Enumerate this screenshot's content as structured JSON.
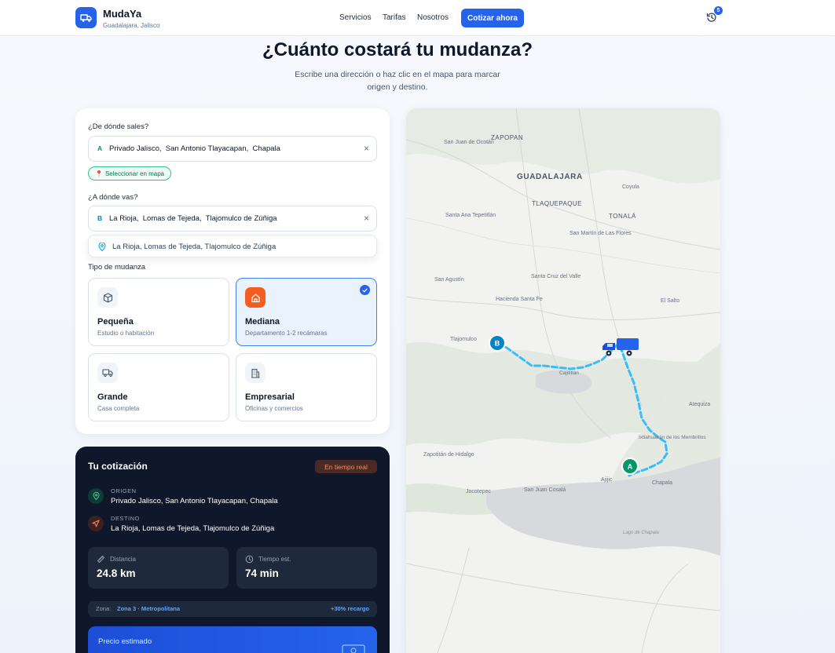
{
  "header": {
    "brand_name": "MudaYa",
    "brand_city": "Guadalajara, Jalisco",
    "nav": [
      "Servicios",
      "Tarifas",
      "Nosotros"
    ],
    "cta_label": "Cotizar ahora",
    "history_count": "5"
  },
  "hero": {
    "title": "¿Cuánto costará tu mudanza?",
    "subtitle": "Escribe una dirección o haz clic en el mapa para marcar origen y destino."
  },
  "form": {
    "origin_label": "¿De dónde sales?",
    "origin_pin": "A",
    "origin_value": "Privado Jalisco,  San Antonio Tlayacapan,  Chapala",
    "select_on_map": "Seleccionar en mapa",
    "dest_label": "¿A dónde vas?",
    "dest_pin": "B",
    "dest_value": "La Rioja,  Lomas de Tejeda,  Tlajomulco de Zúñiga",
    "suggestion": "La Rioja, Lomas de Tejeda, Tlajomulco de Zúñiga",
    "type_label": "Tipo de mudanza",
    "types": [
      {
        "name": "Pequeña",
        "desc": "Estudio o habitación",
        "icon": "box-icon"
      },
      {
        "name": "Mediana",
        "desc": "Departamento 1-2 recámaras",
        "icon": "home-icon",
        "selected": true
      },
      {
        "name": "Grande",
        "desc": "Casa completa",
        "icon": "truck-icon"
      },
      {
        "name": "Empresarial",
        "desc": "Oficinas y comercios",
        "icon": "building-icon"
      }
    ]
  },
  "quote": {
    "title": "Tu cotización",
    "live_badge": "En tiempo real",
    "origin_label": "ORIGEN",
    "origin_value": "Privado Jalisco, San Antonio Tlayacapan, Chapala",
    "dest_label": "DESTINO",
    "dest_value": "La Rioja, Lomas de Tejeda, Tlajomulco de Zúñiga",
    "distance_label": "Distancia",
    "distance_value": "24.8 km",
    "time_label": "Tiempo est.",
    "time_value": "74 min",
    "zone_label": "Zona:",
    "zone_value": "Zona 3 · Metropolitana",
    "zone_extra": "+30% recargo",
    "price_label": "Precio estimado"
  },
  "map": {
    "places": [
      "San Juan de Ocotán",
      "ZAPOPAN",
      "GUADALAJARA",
      "Coyula",
      "TLAQUEPAQUE",
      "TONALÁ",
      "Santa Ana Tepetitlán",
      "San Martín de Las Flores",
      "San Agustín",
      "Santa Cruz del Valle",
      "Hacienda Santa Fe",
      "El Salto",
      "Tlajomulco",
      "Cajititlán",
      "Atequiza",
      "Ixtlahuacán de los Membrillos",
      "Zapotitán de Hidalgo",
      "Ajijic",
      "Chapala",
      "Jocotepec",
      "San Juan Cosalá",
      "Lago de Chapala"
    ],
    "marker_a": "A",
    "marker_b": "B",
    "colors": {
      "route": "#38bdf8",
      "marker_a": "#059669",
      "marker_b": "#0284c7",
      "water": "#d7d9dc"
    }
  }
}
